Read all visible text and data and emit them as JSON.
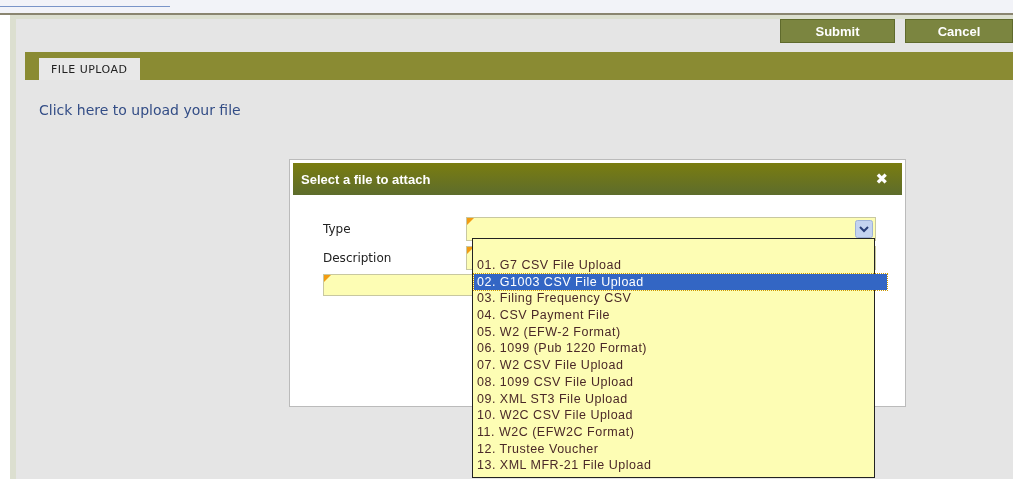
{
  "buttons": [
    {
      "label": "Submit"
    },
    {
      "label": "Cancel"
    }
  ],
  "tabs": [
    {
      "label": "FILE UPLOAD",
      "selected": true
    }
  ],
  "upload_link": "Click here to upload your file",
  "dialog": {
    "title": "Select a file to attach",
    "close": "✖",
    "fields": [
      {
        "label": "Type",
        "kind": "select"
      },
      {
        "label": "Description",
        "kind": "text"
      }
    ],
    "dropdown": {
      "options": [
        {
          "label": "01. G7 CSV File Upload",
          "selected": false
        },
        {
          "label": "02. G1003 CSV File Upload",
          "selected": true
        },
        {
          "label": "03. Filing Frequency CSV",
          "selected": false
        },
        {
          "label": "04. CSV Payment File",
          "selected": false
        },
        {
          "label": "05. W2 (EFW-2 Format)",
          "selected": false
        },
        {
          "label": "06. 1099 (Pub 1220 Format)",
          "selected": false
        },
        {
          "label": "07. W2 CSV File Upload",
          "selected": false
        },
        {
          "label": "08. 1099 CSV File Upload",
          "selected": false
        },
        {
          "label": "09. XML ST3 File Upload",
          "selected": false
        },
        {
          "label": "10. W2C CSV File Upload",
          "selected": false
        },
        {
          "label": "11. W2C (EFW2C Format)",
          "selected": false
        },
        {
          "label": "12. Trustee Voucher",
          "selected": false
        },
        {
          "label": "13. XML MFR-21 File Upload",
          "selected": false
        }
      ]
    }
  }
}
